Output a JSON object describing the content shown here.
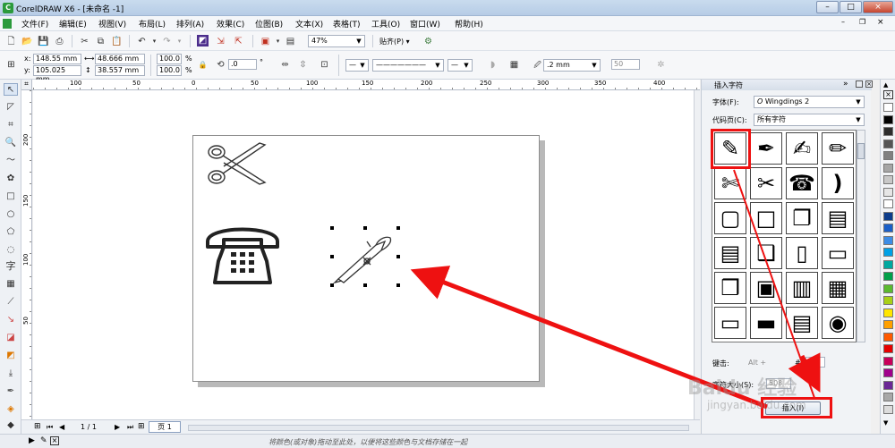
{
  "window": {
    "title": "CorelDRAW X6 - [未命名 -1]",
    "logo_letter": "C",
    "controls": [
      "–",
      "□",
      "×"
    ]
  },
  "menu": [
    "文件(F)",
    "编辑(E)",
    "视图(V)",
    "布局(L)",
    "排列(A)",
    "效果(C)",
    "位图(B)",
    "文本(X)",
    "表格(T)",
    "工具(O)",
    "窗口(W)",
    "帮助(H)"
  ],
  "toolbar1": {
    "zoom": "47%",
    "snap": "贴齐(P)"
  },
  "toolbar2": {
    "x_label": "x:",
    "x": "148.55 mm",
    "y_label": "y:",
    "y": "105.025 mm",
    "width": "48.666 mm",
    "height": "38.557 mm",
    "scale_x": "100.0",
    "scale_y": "100.0",
    "percent": "%",
    "rotation": ".0",
    "degree": "°",
    "outline_width": ".2 mm",
    "text_wrap": "50"
  },
  "ruler": {
    "top_ticks": [
      "100",
      "50",
      "0",
      "50",
      "100",
      "150",
      "200",
      "250",
      "300",
      "350",
      "400"
    ],
    "left_ticks": [
      "200",
      "150",
      "100",
      "50"
    ]
  },
  "docker": {
    "title": "插入字符",
    "font_label": "字体(F):",
    "font_value": "Wingdings 2",
    "codepage_label": "代码页(C):",
    "codepage_value": "所有字符",
    "keystroke_label": "键击:",
    "keystroke_value": "Alt +",
    "hash_label": "#:",
    "hash_value": "33",
    "size_label": "字符大小(S):",
    "size_value": "508",
    "insert_label": "插入(I)",
    "glyphs": [
      [
        "✎",
        "✒",
        "✍",
        "✏"
      ],
      [
        "✄",
        "✂",
        "☎",
        ")"
      ],
      [
        "▢",
        "□",
        "❐",
        "▤"
      ],
      [
        "▤",
        "❑",
        "▯",
        "▭"
      ],
      [
        "❒",
        "▣",
        "▥",
        "▦"
      ],
      [
        "▭",
        "▬",
        "▤",
        "◉"
      ]
    ]
  },
  "docnav": {
    "pages": "1 / 1",
    "tab": "页 1"
  },
  "statusbar": {
    "hint": "将颜色(或对象)拖动至此处，以便将这些颜色与文档存储在一起"
  },
  "watermark": {
    "main": "Baidu 经验",
    "url": "jingyan.baidu.com"
  },
  "colors": {
    "annotation_red": "#ee1111",
    "palette": [
      "#ffffff",
      "#000000",
      "#2d2d2d",
      "#555555",
      "#808080",
      "#a6a6a6",
      "#c8c8c8",
      "#e6e6e6",
      "#ffffff",
      "#0c3c8c",
      "#1a5fc8",
      "#3c8ce6",
      "#00a0e6",
      "#00a8a0",
      "#00a04a",
      "#5aba30",
      "#a8d018",
      "#ffe600",
      "#ffa000",
      "#ff5a00",
      "#e60000",
      "#c8005a",
      "#a0008c",
      "#6a2896",
      "#a8a8a8",
      "#dcdcdc"
    ]
  }
}
